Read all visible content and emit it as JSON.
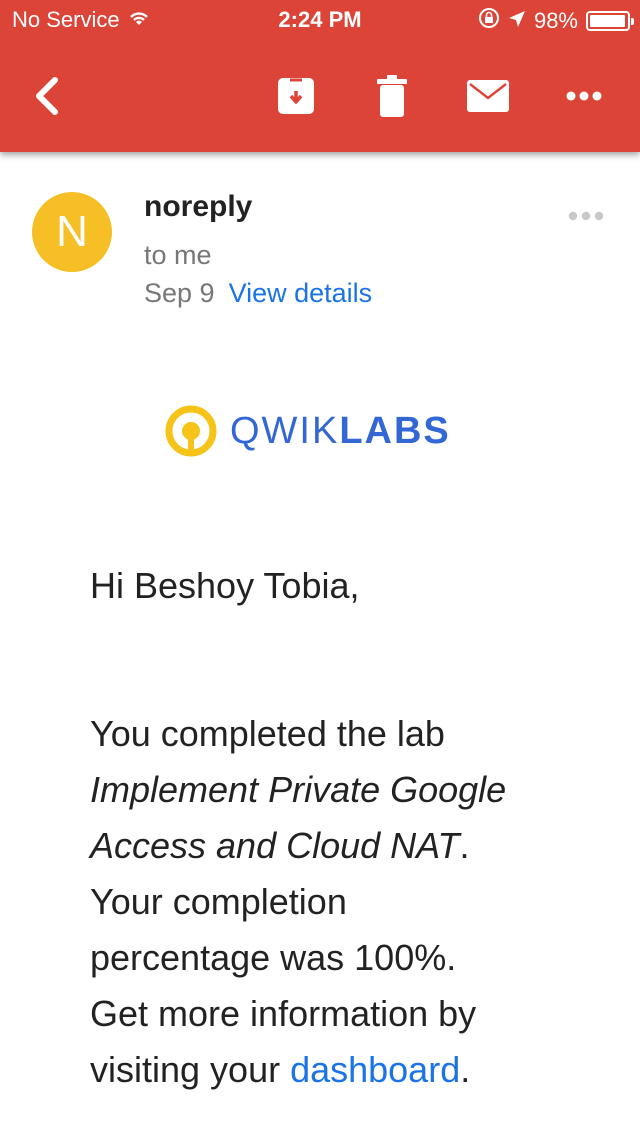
{
  "status_bar": {
    "carrier": "No Service",
    "time": "2:24 PM",
    "battery": "98%",
    "battery_level": 0.98
  },
  "toolbar": {
    "back_icon": "chevron-left-icon",
    "archive_icon": "archive-icon",
    "delete_icon": "trash-icon",
    "mail_icon": "envelope-icon",
    "more_icon": "more-horizontal-icon",
    "background_color": "#db4437"
  },
  "message": {
    "avatar_letter": "N",
    "avatar_color": "#f6bf26",
    "sender": "noreply",
    "recipient": "to me",
    "date": "Sep 9",
    "view_details": "View details"
  },
  "logo": {
    "text_light": "QWIK",
    "text_bold": "LABS"
  },
  "body": {
    "greeting": "Hi Beshoy Tobia,",
    "p1_start": "You completed the lab ",
    "lab_name": "Implement Private Google Access and Cloud NAT",
    "p1_mid": ". Your completion percentage was 100%. Get more information by visiting your ",
    "dashboard_link": "dashboard",
    "p1_end": "."
  }
}
